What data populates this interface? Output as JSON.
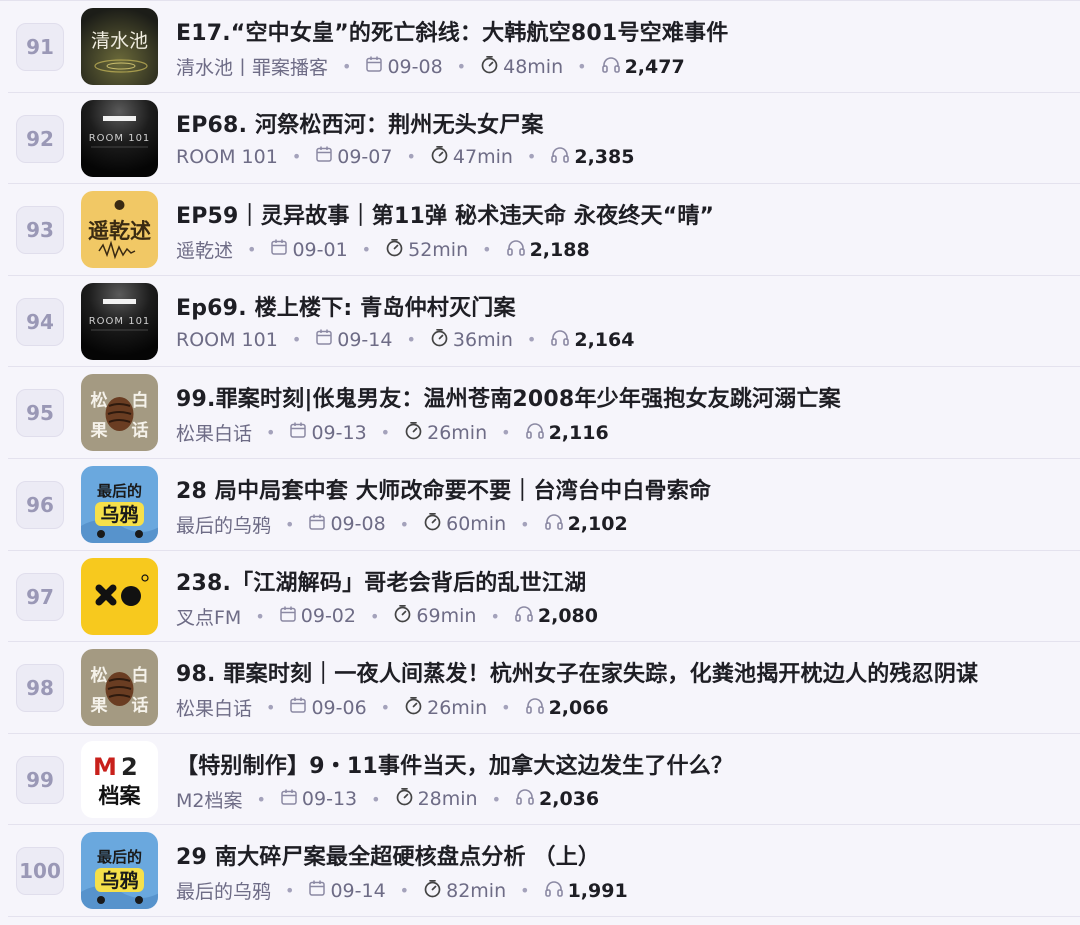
{
  "episodes": [
    {
      "rank": "91",
      "title": "E17.“空中女皇”的死亡斜线：大韩航空801号空难事件",
      "podcast": "清水池丨罪案播客",
      "date": "09-08",
      "duration": "48min",
      "plays": "2,477",
      "cover_text": "清水池",
      "cover_icon": "cover-qingshuichi"
    },
    {
      "rank": "92",
      "title": "EP68. 河祭松西河：荆州无头女尸案",
      "podcast": "ROOM 101",
      "date": "09-07",
      "duration": "47min",
      "plays": "2,385",
      "cover_text": "ROOM 101",
      "cover_icon": "cover-room101"
    },
    {
      "rank": "93",
      "title": "EP59｜灵异故事｜第11弹 秘术违天命 永夜终天“晴”",
      "podcast": "遥乾述",
      "date": "09-01",
      "duration": "52min",
      "plays": "2,188",
      "cover_text": "遥乾述",
      "cover_icon": "cover-yaoqianshu"
    },
    {
      "rank": "94",
      "title": "Ep69. 楼上楼下: 青岛仲村灭门案",
      "podcast": "ROOM 101",
      "date": "09-14",
      "duration": "36min",
      "plays": "2,164",
      "cover_text": "ROOM 101",
      "cover_icon": "cover-room101"
    },
    {
      "rank": "95",
      "title": "99.罪案时刻|伥鬼男友：温州苍南2008年少年强抱女友跳河溺亡案",
      "podcast": "松果白话",
      "date": "09-13",
      "duration": "26min",
      "plays": "2,116",
      "cover_text": "松果白话",
      "cover_icon": "cover-songguo"
    },
    {
      "rank": "96",
      "title": "28 局中局套中套 大师改命要不要｜台湾台中白骨索命",
      "podcast": "最后的乌鸦",
      "date": "09-08",
      "duration": "60min",
      "plays": "2,102",
      "cover_text": "最后的乌鸦",
      "cover_icon": "cover-crow"
    },
    {
      "rank": "97",
      "title": "238.「江湖解码」哥老会背后的乱世江湖",
      "podcast": "叉点FM",
      "date": "09-02",
      "duration": "69min",
      "plays": "2,080",
      "cover_text": "",
      "cover_icon": "cover-chadian"
    },
    {
      "rank": "98",
      "title": "98. 罪案时刻｜一夜人间蒸发！杭州女子在家失踪，化粪池揭开枕边人的残忍阴谋",
      "podcast": "松果白话",
      "date": "09-06",
      "duration": "26min",
      "plays": "2,066",
      "cover_text": "松果白话",
      "cover_icon": "cover-songguo"
    },
    {
      "rank": "99",
      "title": "【特别制作】9・11事件当天，加拿大这边发生了什么？",
      "podcast": "M2档案",
      "date": "09-13",
      "duration": "28min",
      "plays": "2,036",
      "cover_text": "M2档案",
      "cover_icon": "cover-m2"
    },
    {
      "rank": "100",
      "title": "29 南大碎尸案最全超硬核盘点分析 （上）",
      "podcast": "最后的乌鸦",
      "date": "09-14",
      "duration": "82min",
      "plays": "1,991",
      "cover_text": "最后的乌鸦",
      "cover_icon": "cover-crow"
    }
  ],
  "meta_icons": {
    "date": "calendar-icon",
    "duration": "stopwatch-icon",
    "plays": "headphones-icon"
  },
  "colors": {
    "background": "#f6f5fb",
    "rank_badge": "#ecebf5",
    "rank_text": "#9a98b6",
    "meta_text": "#6e6c86"
  }
}
